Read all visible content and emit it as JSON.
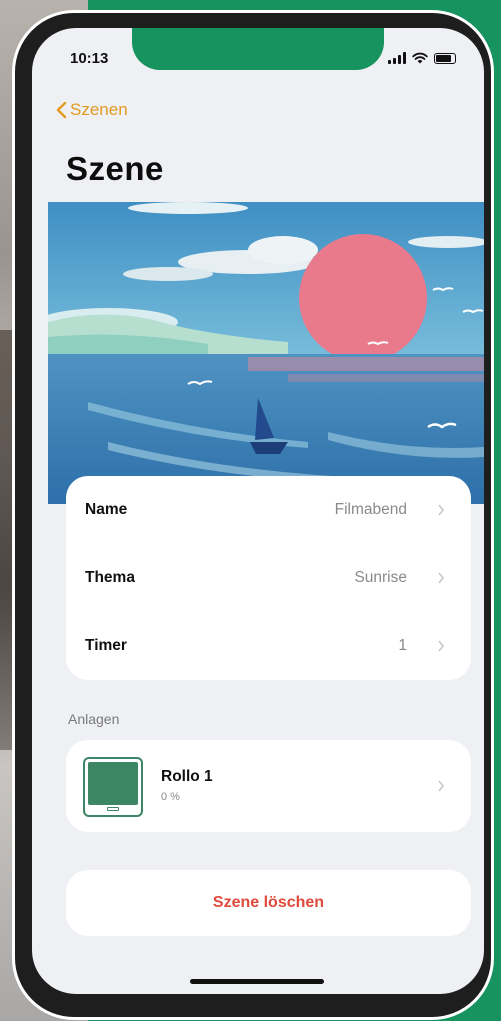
{
  "status_bar": {
    "time": "10:13"
  },
  "nav": {
    "back_label": "Szenen"
  },
  "page": {
    "title": "Szene"
  },
  "settings": [
    {
      "label": "Name",
      "value": "Filmabend"
    },
    {
      "label": "Thema",
      "value": "Sunrise"
    },
    {
      "label": "Timer",
      "value": "1"
    }
  ],
  "devices_section": {
    "label": "Anlagen"
  },
  "devices": [
    {
      "name": "Rollo 1",
      "status": "0 %"
    }
  ],
  "actions": {
    "delete_label": "Szene löschen"
  },
  "colors": {
    "accent": "#e39a22",
    "brand_green": "#17935f",
    "destructive": "#e0493b",
    "device_green": "#3d8664"
  },
  "icons": {
    "back": "chevron-left-icon",
    "row": "chevron-right-icon",
    "device": "roller-shutter-icon"
  }
}
